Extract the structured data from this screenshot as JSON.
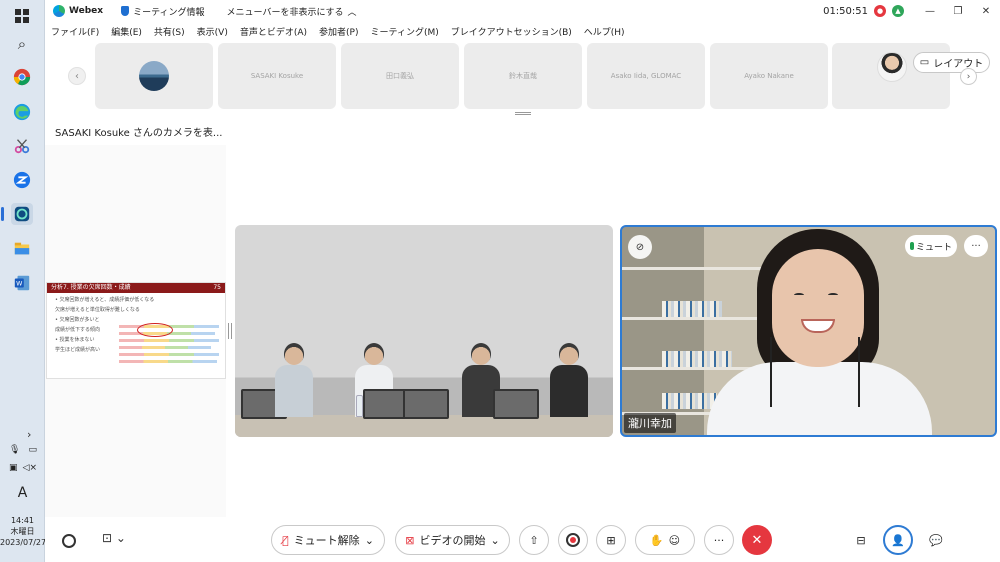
{
  "window": {
    "app_name": "Webex",
    "meeting_info_label": "ミーティング情報",
    "hide_menu_label": "メニューバーを非表示にする",
    "timer": "01:50:51",
    "minimize": "—",
    "restore": "❐",
    "close": "✕"
  },
  "menu": [
    "ファイル(F)",
    "編集(E)",
    "共有(S)",
    "表示(V)",
    "音声とビデオ(A)",
    "参加者(P)",
    "ミーティング(M)",
    "ブレイクアウトセッション(B)",
    "ヘルプ(H)"
  ],
  "filmstrip": {
    "tiles": [
      "",
      "SASAKI Kosuke",
      "田口義弘",
      "鈴木直哉",
      "Asako Iida, GLOMAC",
      "Ayako Nakane",
      ""
    ],
    "layout_label": "レイアウト"
  },
  "content": {
    "panel_title": "SASAKI Kosuke さんのカメラを表...",
    "slide_title": "分析7. 授業の欠席回数・成績",
    "slide_page": "75",
    "slide_lines": [
      "• 欠席回数が増えると、成績評価が低くなる",
      "欠席が増えると単位取得が難しくなる",
      "• 欠席回数が多いと",
      "  成績が低下する傾向",
      "• 授業を休まない",
      "  学生ほど成績が高い"
    ]
  },
  "active_speaker": {
    "name": "瀧川幸加",
    "mute_label": "ミュート",
    "more_label": "···"
  },
  "controls": {
    "unmute_label": "ミュート解除",
    "start_video_label": "ビデオの開始",
    "more_label": "···"
  },
  "taskbar": {
    "time": "14:41",
    "day": "木曜日",
    "date": "2023/07/27",
    "ime": "A"
  },
  "colors": {
    "accent": "#2e7bd3",
    "leave": "#e5373f",
    "slide_header": "#8b1a1a"
  }
}
